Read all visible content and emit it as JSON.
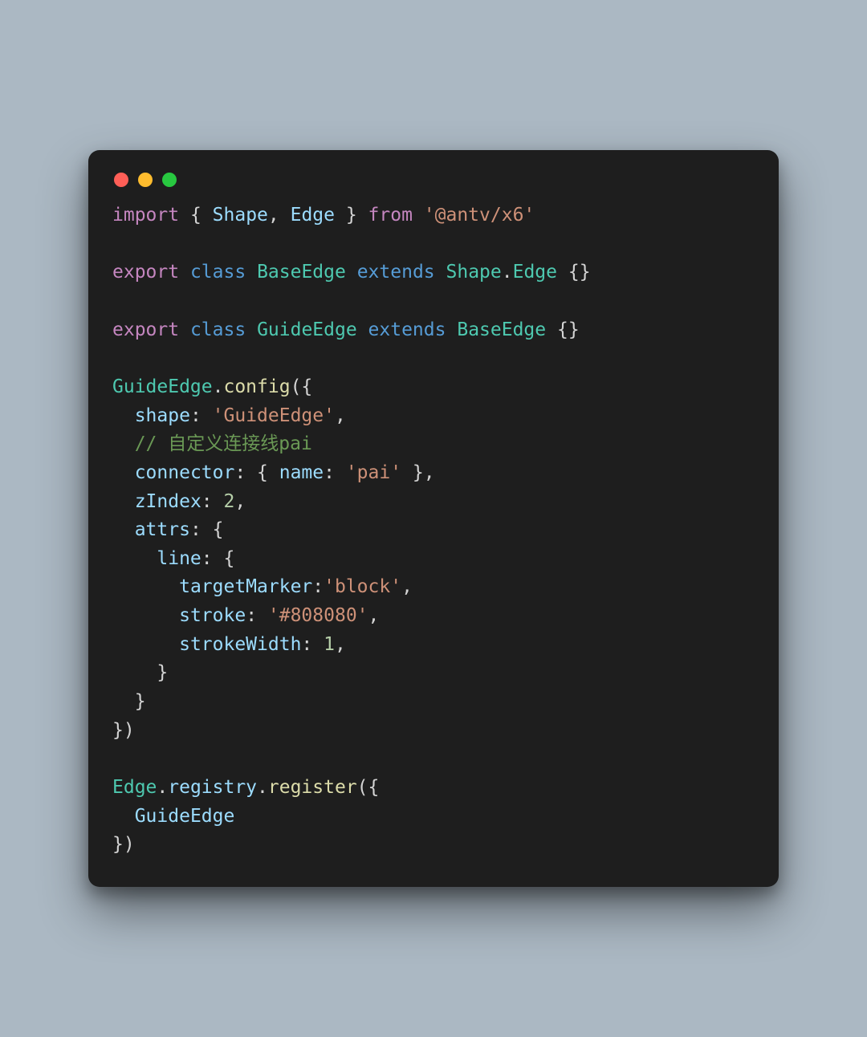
{
  "tokens": {
    "import": "import",
    "from": "from",
    "export": "export",
    "class": "class",
    "extends": "extends",
    "Shape": "Shape",
    "Edge": "Edge",
    "BaseEdge": "BaseEdge",
    "GuideEdge": "GuideEdge",
    "config": "config",
    "shape": "shape",
    "connector": "connector",
    "name": "name",
    "zIndex": "zIndex",
    "attrs": "attrs",
    "line": "line",
    "targetMarker": "targetMarker",
    "stroke": "stroke",
    "strokeWidth": "strokeWidth",
    "registry": "registry",
    "register": "register",
    "pkg": "'@antv/x6'",
    "val_shape": "'GuideEdge'",
    "val_pai": "'pai'",
    "val_block": "'block'",
    "val_stroke": "'#808080'",
    "num_2": "2",
    "num_1": "1",
    "comment": "// 自定义连接线pai"
  }
}
